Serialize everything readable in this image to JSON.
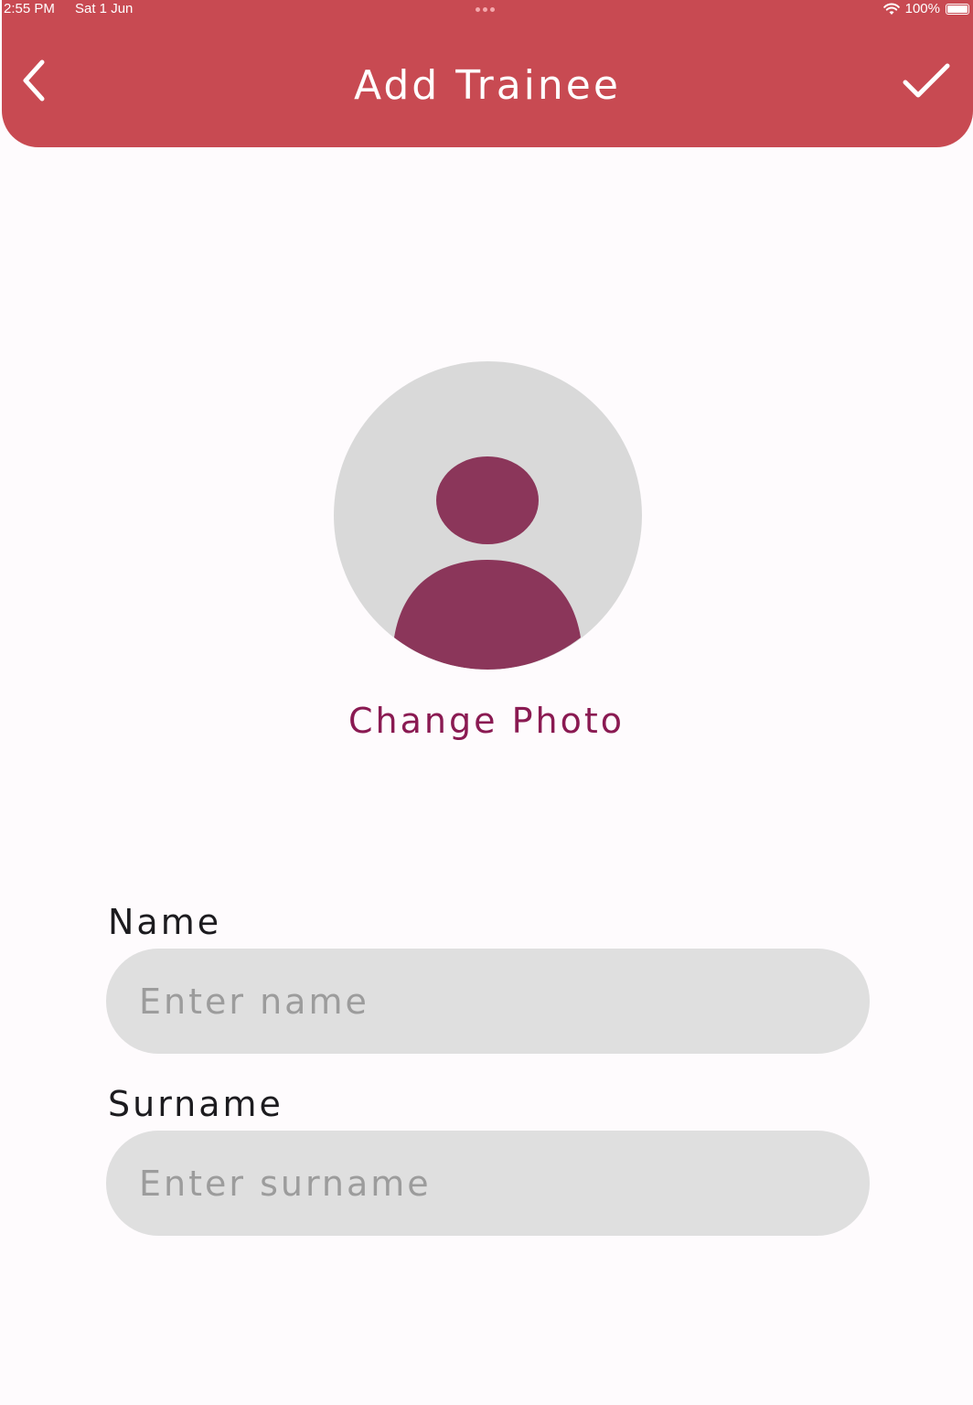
{
  "status_bar": {
    "time": "2:55 PM",
    "date": "Sat 1 Jun",
    "battery": "100%"
  },
  "header": {
    "title": "Add Trainee",
    "back_icon": "chevron-left-icon",
    "confirm_icon": "checkmark-icon"
  },
  "avatar": {
    "icon": "person-icon"
  },
  "change_photo_label": "Change Photo",
  "form": {
    "name": {
      "label": "Name",
      "placeholder": "Enter name",
      "value": ""
    },
    "surname": {
      "label": "Surname",
      "placeholder": "Enter surname",
      "value": ""
    }
  },
  "colors": {
    "header_bg": "#c84a52",
    "accent": "#8a1a52",
    "avatar_figure": "#8b365a",
    "avatar_bg": "#d9d9d9",
    "input_bg": "#dfdfdf",
    "page_bg": "#fefbfd"
  }
}
